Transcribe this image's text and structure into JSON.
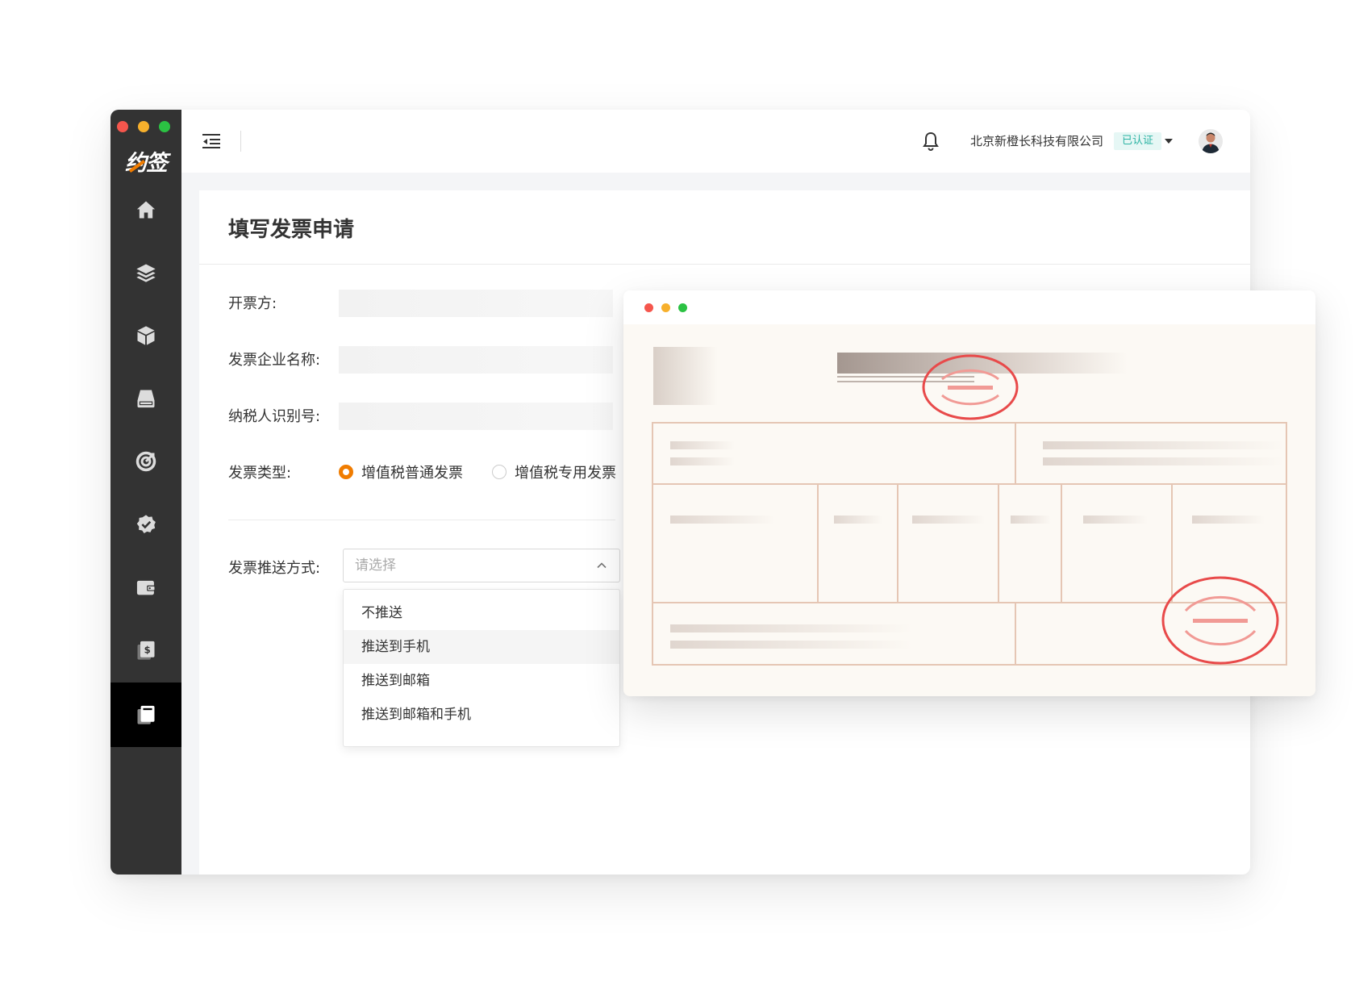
{
  "colors": {
    "sidebar": "#333333",
    "sidebar_active": "#000000",
    "accent": "#f07c00",
    "verified_text": "#2bb3a3",
    "verified_bg": "#e6f7f5",
    "stamp": "#e84a4a",
    "traffic_red": "#f5564d",
    "traffic_yellow": "#f7b02c",
    "traffic_green": "#2bc243"
  },
  "app": {
    "logo_text": "约签"
  },
  "sidebar": {
    "items": [
      {
        "icon": "home-icon",
        "active": false
      },
      {
        "icon": "layers-icon",
        "active": false
      },
      {
        "icon": "box-icon",
        "active": false
      },
      {
        "icon": "drive-icon",
        "active": false
      },
      {
        "icon": "target-icon",
        "active": false
      },
      {
        "icon": "verified-badge-icon",
        "active": false
      },
      {
        "icon": "wallet-icon",
        "active": false
      },
      {
        "icon": "dollar-document-icon",
        "active": false
      },
      {
        "icon": "invoice-copy-icon",
        "active": true
      }
    ]
  },
  "topbar": {
    "company": "北京新橙长科技有限公司",
    "verified_label": "已认证"
  },
  "page": {
    "title": "填写发票申请"
  },
  "form": {
    "issuer_label": "开票方:",
    "company_name_label": "发票企业名称:",
    "tax_id_label": "纳税人识别号:",
    "invoice_type_label": "发票类型:",
    "invoice_types": [
      {
        "label": "增值税普通发票",
        "checked": true
      },
      {
        "label": "增值税专用发票",
        "checked": false
      }
    ],
    "push_method_label": "发票推送方式:",
    "push_select": {
      "placeholder": "请选择",
      "expanded": true,
      "options": [
        "不推送",
        "推送到手机",
        "推送到邮箱",
        "推送到邮箱和手机"
      ],
      "hovered_index": 1
    }
  }
}
